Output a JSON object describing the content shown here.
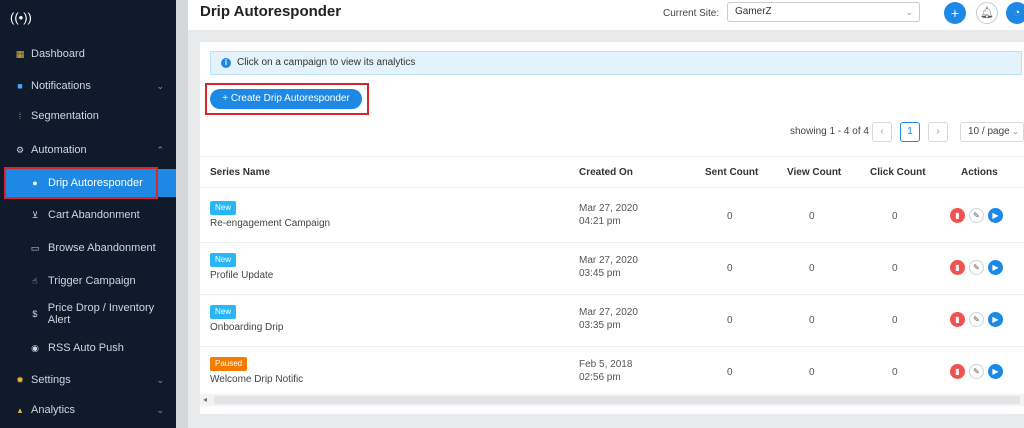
{
  "sidebar": {
    "logo_icon": "broadcast-icon",
    "items": [
      {
        "label": "Dashboard",
        "icon": "grid-icon"
      },
      {
        "label": "Notifications",
        "icon": "bell-icon"
      },
      {
        "label": "Segmentation",
        "icon": "segment-icon"
      },
      {
        "label": "Automation",
        "icon": "automation-icon"
      },
      {
        "label": "Drip Autoresponder",
        "icon": "drop-icon"
      },
      {
        "label": "Cart Abandonment",
        "icon": "cart-icon"
      },
      {
        "label": "Browse Abandonment",
        "icon": "browse-icon"
      },
      {
        "label": "Trigger Campaign",
        "icon": "trigger-icon"
      },
      {
        "label": "Price Drop / Inventory Alert",
        "icon": "dollar-icon"
      },
      {
        "label": "RSS Auto Push",
        "icon": "rss-icon"
      },
      {
        "label": "Settings",
        "icon": "gear-icon"
      },
      {
        "label": "Analytics",
        "icon": "chart-icon"
      }
    ]
  },
  "header": {
    "title": "Drip Autoresponder",
    "site_label": "Current Site:",
    "site_value": "GamerZ"
  },
  "main": {
    "info_text": "Click on a campaign to view its analytics",
    "create_button": "Create Drip Autoresponder",
    "pagination": {
      "showing": "showing 1 - 4 of 4",
      "prev": "‹",
      "current_page": "1",
      "next": "›",
      "per_page": "10 / page"
    },
    "table": {
      "columns": {
        "series_name": "Series Name",
        "created_on": "Created On",
        "sent_count": "Sent Count",
        "view_count": "View Count",
        "click_count": "Click Count",
        "actions": "Actions"
      },
      "rows": [
        {
          "status": "New",
          "name": "Re-engagement Campaign",
          "date": "Mar 27, 2020",
          "time": "04:21 pm",
          "sent": "0",
          "view": "0",
          "click": "0"
        },
        {
          "status": "New",
          "name": "Profile Update",
          "date": "Mar 27, 2020",
          "time": "03:45 pm",
          "sent": "0",
          "view": "0",
          "click": "0"
        },
        {
          "status": "New",
          "name": "Onboarding Drip",
          "date": "Mar 27, 2020",
          "time": "03:35 pm",
          "sent": "0",
          "view": "0",
          "click": "0"
        },
        {
          "status": "Paused",
          "name": "Welcome Drip Notific",
          "date": "Feb 5, 2018",
          "time": "02:56 pm",
          "sent": "0",
          "view": "0",
          "click": "0"
        }
      ]
    }
  },
  "colors": {
    "sidebar_bg": "#0f1a2b",
    "accent": "#1e88e5",
    "highlight": "#d8262f",
    "badge_new": "#29b6f6",
    "badge_paused": "#f57c00",
    "delete": "#ef5350"
  }
}
